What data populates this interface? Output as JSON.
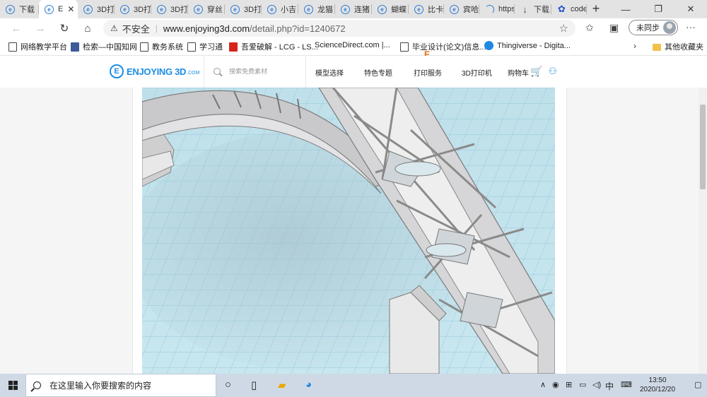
{
  "browser": {
    "tabs": [
      {
        "label": "下载",
        "icon": "edge-page-icon",
        "active": false
      },
      {
        "label": "E",
        "icon": "edge-page-icon",
        "active": true
      },
      {
        "label": "3D打",
        "icon": "edge-page-icon",
        "active": false
      },
      {
        "label": "3D打",
        "icon": "edge-page-icon",
        "active": false
      },
      {
        "label": "3D打",
        "icon": "edge-page-icon",
        "active": false
      },
      {
        "label": "穿丝",
        "icon": "edge-page-icon",
        "active": false
      },
      {
        "label": "3D打",
        "icon": "edge-page-icon",
        "active": false
      },
      {
        "label": "小吉",
        "icon": "edge-page-icon",
        "active": false
      },
      {
        "label": "龙猫",
        "icon": "edge-page-icon",
        "active": false
      },
      {
        "label": "连猪",
        "icon": "edge-page-icon",
        "active": false
      },
      {
        "label": "蝴蝶",
        "icon": "edge-page-icon",
        "active": false
      },
      {
        "label": "比卡",
        "icon": "edge-page-icon",
        "active": false
      },
      {
        "label": "宾哈",
        "icon": "edge-page-icon",
        "active": false
      },
      {
        "label": "https",
        "icon": "loading-icon",
        "active": false
      },
      {
        "label": "下载",
        "icon": "download-icon",
        "active": false
      },
      {
        "label": "code",
        "icon": "baidu-paw-icon",
        "active": false
      }
    ],
    "tab_close": "✕",
    "new_tab": "+",
    "window_buttons": {
      "minimize": "—",
      "restore": "❐",
      "close": "✕"
    },
    "address": {
      "security_icon": "⚠",
      "security_label": "不安全",
      "url_domain": "www.enjoying3d.com",
      "url_path": "/detail.php?id=1240672"
    },
    "profile_label": "未同步",
    "more_menu": "···",
    "bookmarks": [
      {
        "label": "网络教学平台",
        "icon": "page-icon"
      },
      {
        "label": "检索—中国知网",
        "icon": "cnki-icon"
      },
      {
        "label": "教务系统",
        "icon": "page-icon"
      },
      {
        "label": "学习通",
        "icon": "page-icon"
      },
      {
        "label": "吾爱破解 - LCG - LS...",
        "icon": "52pojie-icon"
      },
      {
        "label": "ScienceDirect.com |...",
        "icon": "elsevier-icon"
      },
      {
        "label": "毕业设计(论文)信息...",
        "icon": "page-icon"
      },
      {
        "label": "Thingiverse - Digita...",
        "icon": "thingiverse-icon"
      }
    ],
    "bookmarks_overflow": "›",
    "other_bookmarks": "其他收藏夹"
  },
  "site": {
    "logo_text": "ENJOYING 3D",
    "logo_suffix": ".COM",
    "search_placeholder": "搜索免费素材",
    "nav": [
      "模型选择",
      "特色专题",
      "打印服务",
      "3D打印机",
      "购物车"
    ]
  },
  "taskbar": {
    "search_text": "在这里输入你要搜索的内容",
    "ime": "中",
    "time": "13:50",
    "date": "2020/12/20"
  }
}
